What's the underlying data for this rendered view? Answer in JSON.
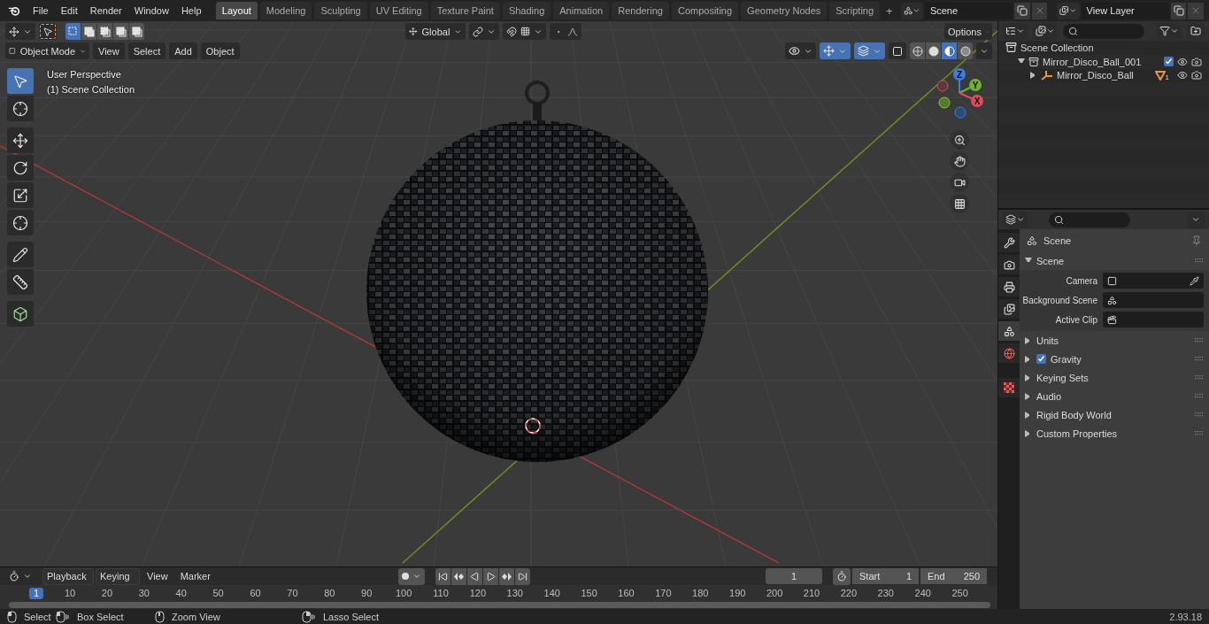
{
  "top_bar": {
    "menus": [
      "File",
      "Edit",
      "Render",
      "Window",
      "Help"
    ],
    "workspaces": [
      {
        "label": "Layout",
        "selected": true
      },
      {
        "label": "Modeling",
        "selected": false
      },
      {
        "label": "Sculpting",
        "selected": false
      },
      {
        "label": "UV Editing",
        "selected": false
      },
      {
        "label": "Texture Paint",
        "selected": false
      },
      {
        "label": "Shading",
        "selected": false
      },
      {
        "label": "Animation",
        "selected": false
      },
      {
        "label": "Rendering",
        "selected": false
      },
      {
        "label": "Compositing",
        "selected": false
      },
      {
        "label": "Geometry Nodes",
        "selected": false
      },
      {
        "label": "Scripting",
        "selected": false
      }
    ],
    "add_workspace": "+",
    "scene": "Scene",
    "view_layer": "View Layer"
  },
  "viewport": {
    "select_modes": [
      {
        "kind": "new",
        "selected": true
      },
      {
        "kind": "extend",
        "selected": false
      },
      {
        "kind": "subtract",
        "selected": false
      },
      {
        "kind": "invert",
        "selected": false
      },
      {
        "kind": "intersect",
        "selected": false
      }
    ],
    "orientation": "Global",
    "options": "Options",
    "mode": "Object Mode",
    "menus": [
      "View",
      "Select",
      "Add",
      "Object"
    ],
    "toggles": [
      {
        "kind": "visibility",
        "on": false
      },
      {
        "kind": "gizmos",
        "on": true
      },
      {
        "kind": "overlays",
        "on": true
      },
      {
        "kind": "xray",
        "on": false
      }
    ],
    "shading": [
      {
        "kind": "wireframe",
        "selected": false
      },
      {
        "kind": "solid",
        "selected": false
      },
      {
        "kind": "material",
        "selected": true
      },
      {
        "kind": "rendered",
        "selected": false
      }
    ],
    "view_name": "User Perspective",
    "collection": "(1) Scene Collection",
    "tools": [
      {
        "kind": "select",
        "selected": true
      },
      {
        "kind": "cursor",
        "selected": false
      },
      {
        "kind": "move",
        "selected": false
      },
      {
        "kind": "rotate",
        "selected": false
      },
      {
        "kind": "scale",
        "selected": false
      },
      {
        "kind": "transform",
        "selected": false
      },
      {
        "kind": "annotate",
        "selected": false
      },
      {
        "kind": "measure",
        "selected": false
      },
      {
        "kind": "add_cube",
        "selected": false
      }
    ],
    "gizmo": {
      "x": "X",
      "y": "Y",
      "z": "Z"
    }
  },
  "outliner": {
    "root": {
      "label": "Scene Collection",
      "kind": "scene_collection",
      "children": [
        {
          "label": "Mirror_Disco_Ball_001",
          "kind": "collection",
          "expanded": true,
          "checked": true,
          "children": [
            {
              "label": "Mirror_Disco_Ball",
              "kind": "object",
              "expanded": false,
              "data_count": "1"
            }
          ]
        }
      ]
    }
  },
  "properties": {
    "tabs": [
      {
        "kind": "tool",
        "selected": false
      },
      {
        "kind": "render",
        "selected": false
      },
      {
        "kind": "output",
        "selected": false
      },
      {
        "kind": "view_layer",
        "selected": false
      },
      {
        "kind": "scene",
        "selected": true
      },
      {
        "kind": "world",
        "selected": false
      },
      {
        "kind": "texture",
        "selected": false
      }
    ],
    "context": "Scene",
    "panel": {
      "title": "Scene",
      "expanded": true,
      "fields": [
        {
          "label": "Camera",
          "kind": "camera"
        },
        {
          "label": "Background Scene",
          "kind": "scene"
        },
        {
          "label": "Active Clip",
          "kind": "clip"
        }
      ]
    },
    "subpanels": [
      {
        "label": "Units",
        "expanded": false
      },
      {
        "label": "Gravity",
        "expanded": false,
        "checked": true
      },
      {
        "label": "Keying Sets",
        "expanded": false
      },
      {
        "label": "Audio",
        "expanded": false
      },
      {
        "label": "Rigid Body World",
        "expanded": false
      },
      {
        "label": "Custom Properties",
        "expanded": false
      }
    ]
  },
  "timeline": {
    "menus": [
      {
        "label": "Playback",
        "kind": "dropdown"
      },
      {
        "label": "Keying",
        "kind": "dropdown"
      },
      {
        "label": "View",
        "kind": "menu"
      },
      {
        "label": "Marker",
        "kind": "menu"
      }
    ],
    "current_frame": "1",
    "start_label": "Start",
    "start": "1",
    "end_label": "End",
    "end": "250",
    "ruler": [
      {
        "label": "1",
        "selected": true
      },
      {
        "label": "10",
        "selected": false
      },
      {
        "label": "20",
        "selected": false
      },
      {
        "label": "30",
        "selected": false
      },
      {
        "label": "40",
        "selected": false
      },
      {
        "label": "50",
        "selected": false
      },
      {
        "label": "60",
        "selected": false
      },
      {
        "label": "70",
        "selected": false
      },
      {
        "label": "80",
        "selected": false
      },
      {
        "label": "90",
        "selected": false
      },
      {
        "label": "100",
        "selected": false
      },
      {
        "label": "110",
        "selected": false
      },
      {
        "label": "120",
        "selected": false
      },
      {
        "label": "130",
        "selected": false
      },
      {
        "label": "140",
        "selected": false
      },
      {
        "label": "150",
        "selected": false
      },
      {
        "label": "160",
        "selected": false
      },
      {
        "label": "170",
        "selected": false
      },
      {
        "label": "180",
        "selected": false
      },
      {
        "label": "190",
        "selected": false
      },
      {
        "label": "200",
        "selected": false
      },
      {
        "label": "210",
        "selected": false
      },
      {
        "label": "220",
        "selected": false
      },
      {
        "label": "230",
        "selected": false
      },
      {
        "label": "240",
        "selected": false
      },
      {
        "label": "250",
        "selected": false
      }
    ]
  },
  "status_bar": {
    "hints": [
      {
        "label": "Select",
        "kind": "lmb"
      },
      {
        "label": "Box Select",
        "kind": "lmb_drag"
      },
      {
        "label": "Zoom View",
        "kind": "mmb"
      },
      {
        "label": "Lasso Select",
        "kind": "rmb_drag"
      }
    ],
    "version": "2.93.18"
  }
}
